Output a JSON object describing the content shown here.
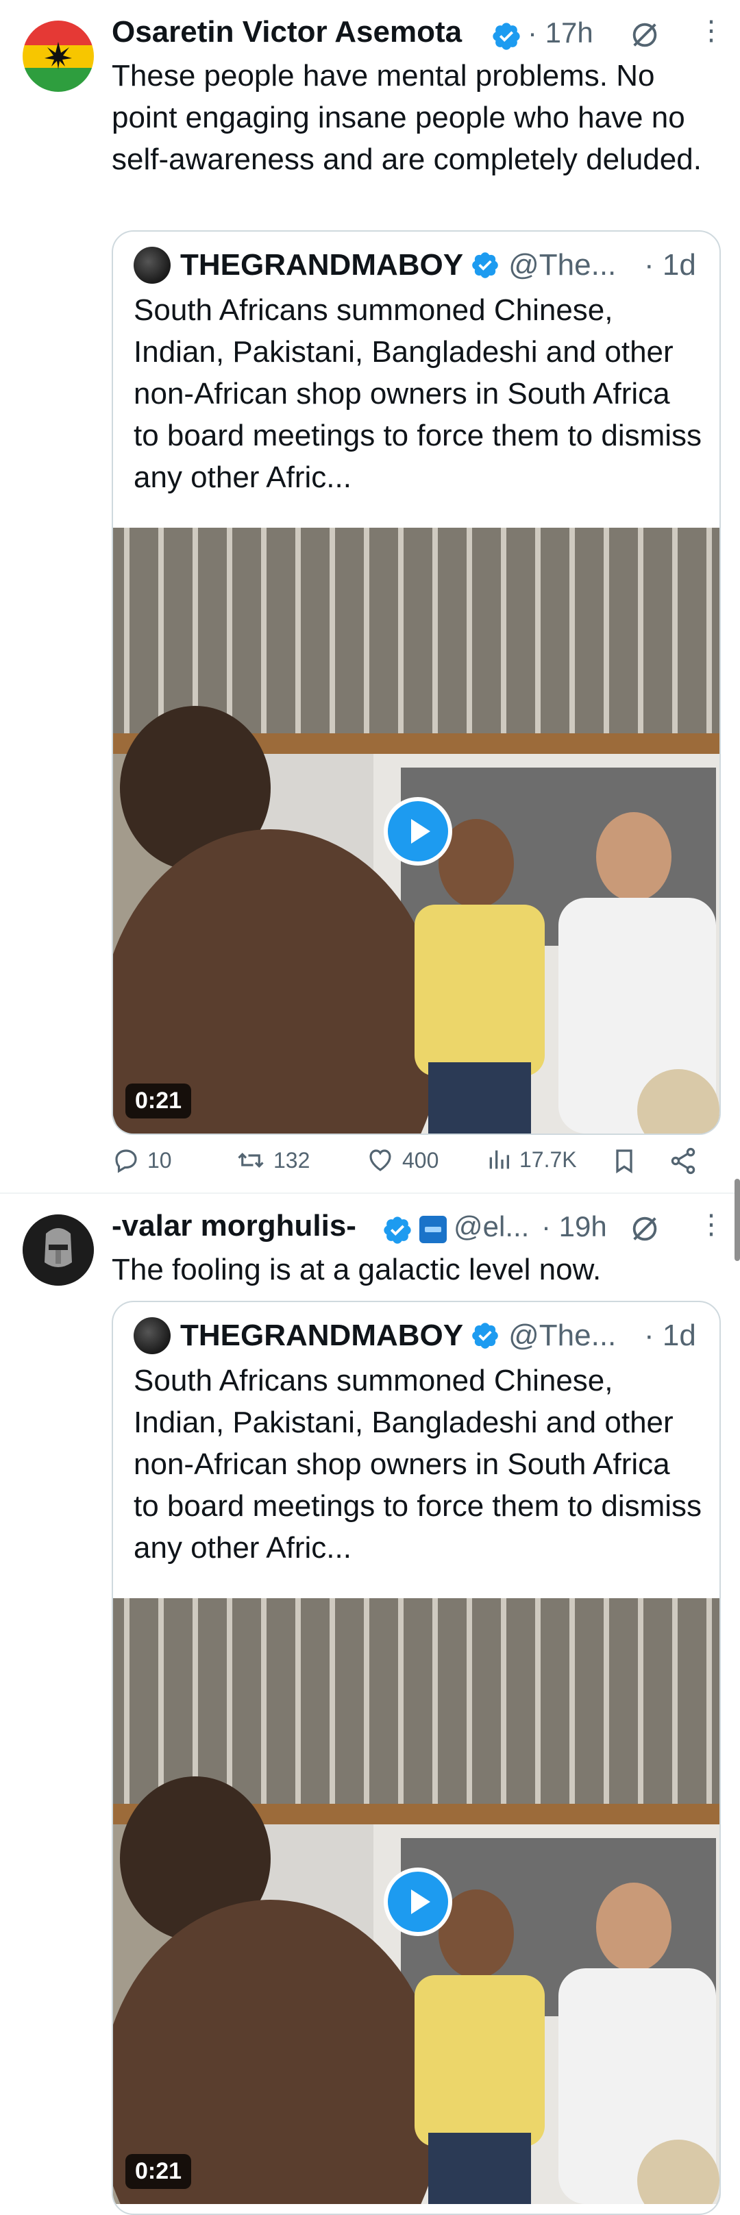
{
  "posts": [
    {
      "author": "Osaretin Victor Asemota",
      "time": "· 17h",
      "text": "These people have mental problems. No point engaging insane people who have no self-awareness and are completely deluded.",
      "quote": {
        "author": "THEGRANDMABOY",
        "handle": "@The...",
        "time": "· 1d",
        "text": "South Africans summoned Chinese, Indian, Pakistani, Bangladeshi and other non-African shop owners in South Africa to board meetings to force them to dismiss any other Afric...",
        "duration": "0:21"
      },
      "actions": {
        "replies": "10",
        "reposts": "132",
        "likes": "400",
        "views": "17.7K"
      }
    },
    {
      "author": "-valar morghulis-",
      "handle": "@el...",
      "time": "· 19h",
      "text": "The fooling is at a galactic level now.",
      "quote": {
        "author": "THEGRANDMABOY",
        "handle": "@The...",
        "time": "· 1d",
        "text": "South Africans summoned Chinese, Indian, Pakistani, Bangladeshi and other non-African shop owners in South Africa to board meetings to force them to dismiss any other Afric...",
        "duration": "0:21"
      }
    }
  ],
  "colors": {
    "accent": "#1d9bf0",
    "secondary_text": "#536471",
    "border": "#cfd9de"
  }
}
